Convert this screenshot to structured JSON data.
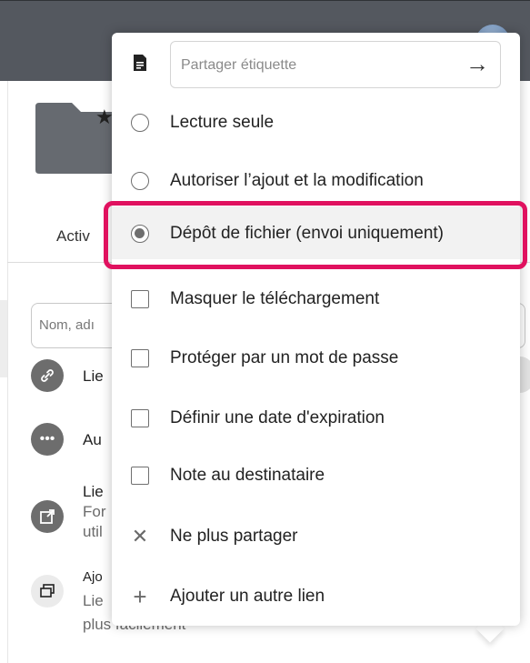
{
  "background": {
    "activity_tab": "Activ",
    "search_placeholder": "Nom, adı",
    "shares": [
      {
        "icon": "link-icon",
        "line1": "Lie",
        "line2": "",
        "line3": ""
      },
      {
        "icon": "more-icon",
        "line1": "Au",
        "line2": "",
        "line3": ""
      },
      {
        "icon": "external-link-icon",
        "line1": "Lie",
        "line2": "For",
        "line3": "util"
      },
      {
        "icon": "windows-icon",
        "line1": "Ajo",
        "line2": "Lie",
        "line3": "plus facilement"
      }
    ]
  },
  "menu": {
    "label_input": {
      "placeholder": "Partager étiquette",
      "submit_icon": "arrow-right-icon"
    },
    "options": [
      {
        "type": "radio",
        "label": "Lecture seule",
        "checked": false
      },
      {
        "type": "radio",
        "label": "Autoriser l’ajout et la modification",
        "checked": false
      },
      {
        "type": "radio",
        "label": "Dépôt de fichier (envoi uniquement)",
        "checked": true
      },
      {
        "type": "checkbox",
        "label": "Masquer le téléchargement",
        "checked": false
      },
      {
        "type": "checkbox",
        "label": "Protéger par un mot de passe",
        "checked": false
      },
      {
        "type": "checkbox",
        "label": "Définir une date d'expiration",
        "checked": false
      },
      {
        "type": "checkbox",
        "label": "Note au destinataire",
        "checked": false
      },
      {
        "type": "action",
        "label": "Ne plus partager",
        "icon": "close-icon"
      },
      {
        "type": "action",
        "label": "Ajouter un autre lien",
        "icon": "plus-icon"
      }
    ]
  },
  "colors": {
    "header": "#54585f",
    "highlight": "#e0115f",
    "selected_row": "#f2f2f2"
  }
}
